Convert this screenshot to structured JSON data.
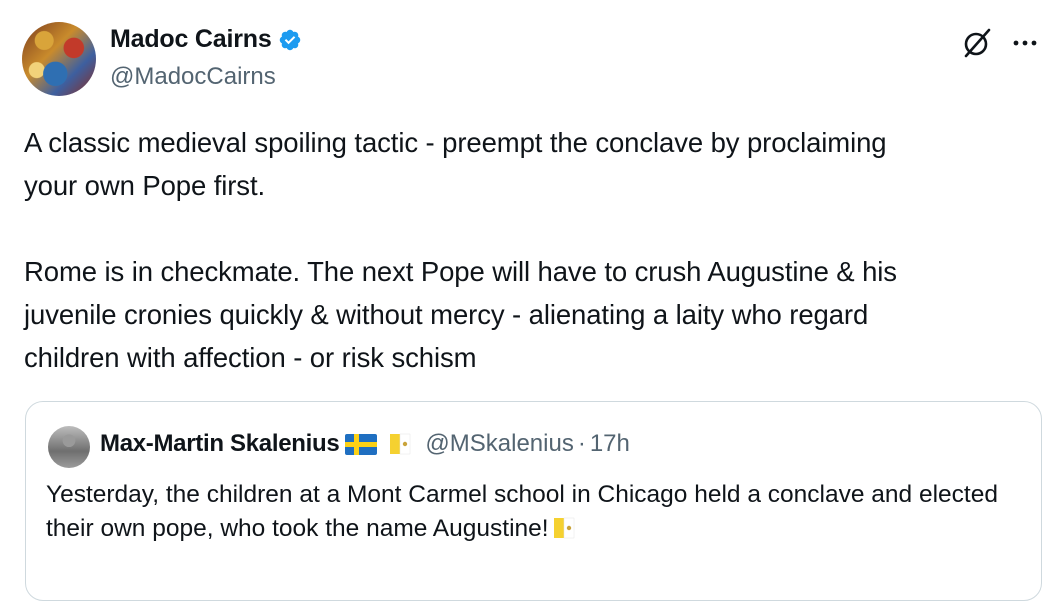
{
  "author": {
    "display_name": "Madoc Cairns",
    "handle": "@MadocCairns",
    "verified": true,
    "avatar_icon": "avatar-image"
  },
  "actions": {
    "grok_icon": "grok-icon",
    "more_icon": "more-options-icon"
  },
  "tweet": {
    "text": "A classic medieval spoiling tactic - preempt the conclave by proclaiming\nyour own Pope first.\n\nRome is in checkmate. The next Pope will have to crush Augustine & his\njuvenile cronies quickly & without mercy - alienating a laity who regard\nchildren with affection - or risk schism"
  },
  "quote": {
    "display_name": "Max-Martin Skalenius",
    "flags": [
      "sweden-flag",
      "vatican-flag"
    ],
    "handle": "@MSkalenius",
    "separator": "·",
    "time": "17h",
    "text": "Yesterday, the children at a Mont Carmel school in Chicago held a conclave and elected their own pope, who took the name Augustine!",
    "text_trailing_icon": "vatican-flag"
  },
  "colors": {
    "verified_blue": "#1d9bf0",
    "secondary_text": "#536471",
    "border": "#cfd9de"
  }
}
